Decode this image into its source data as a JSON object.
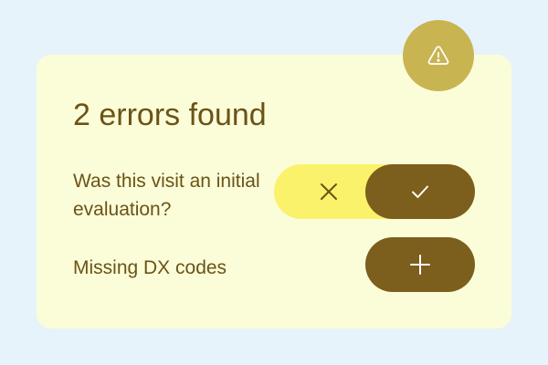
{
  "card": {
    "title": "2 errors found",
    "icon": "warning-triangle-icon"
  },
  "issues": [
    {
      "label": "Was this visit an initial evaluation?",
      "options": [
        {
          "icon": "close-icon",
          "selected": false
        },
        {
          "icon": "check-icon",
          "selected": true
        }
      ]
    },
    {
      "label": "Missing DX codes",
      "action_icon": "plus-icon"
    }
  ],
  "colors": {
    "background": "#e7f3fa",
    "card": "#fbfdd9",
    "text": "#6b5316",
    "badge": "#c9b452",
    "toggle_track": "#fbf26c",
    "active_button": "#7c5e1d"
  }
}
